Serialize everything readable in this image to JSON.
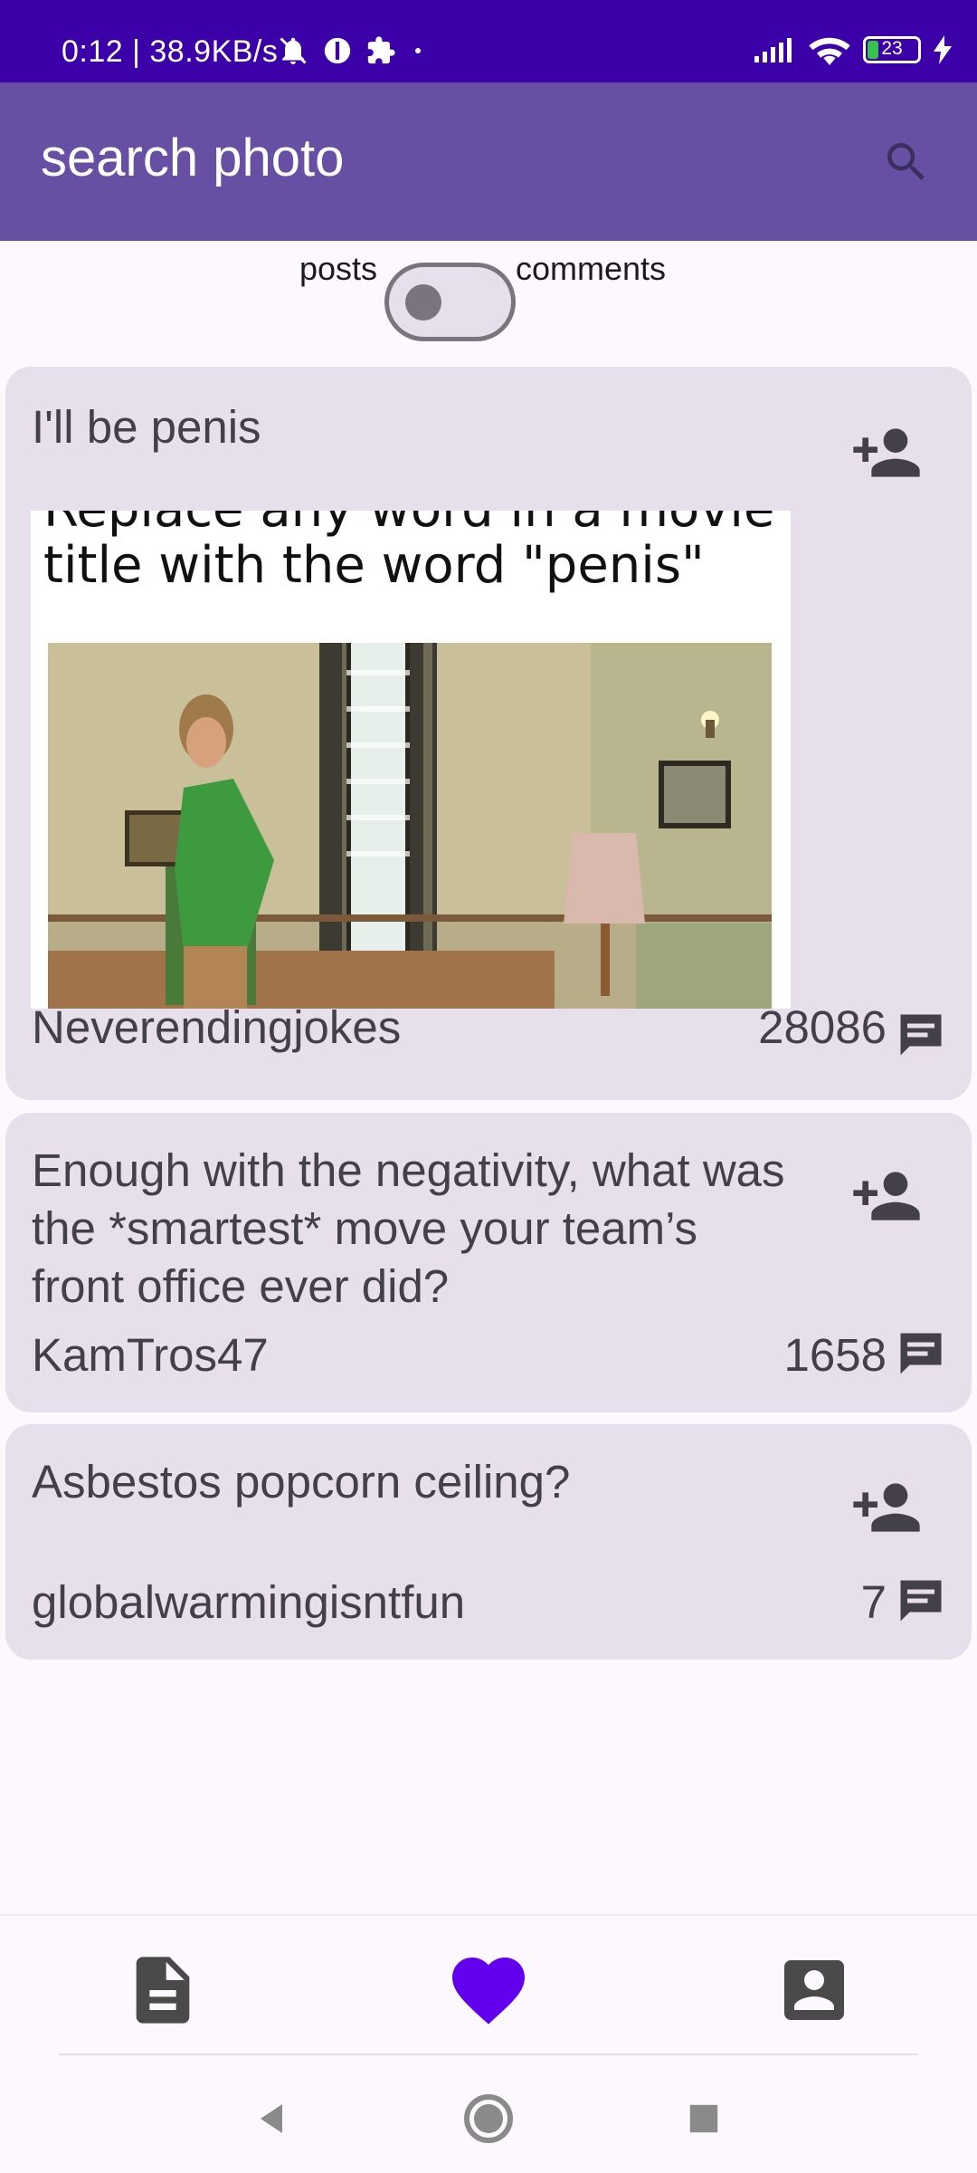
{
  "status_bar": {
    "time_and_speed": "0:12 | 38.9KB/s",
    "battery_level": "23",
    "battery_fraction": 0.23
  },
  "app_bar": {
    "title": "search photo",
    "search_icon": "search-icon"
  },
  "filter": {
    "left_label": "posts",
    "right_label": "comments",
    "selected": "posts"
  },
  "posts": [
    {
      "title": "I'll be penis",
      "image_caption": "Replace any word in a movie title with the word \"penis\"",
      "author": "Neverendingjokes",
      "comment_count": "28086"
    },
    {
      "title": "Enough with the negativity, what was the *smartest* move your team’s front office ever did?",
      "author": "KamTros47",
      "comment_count": "1658"
    },
    {
      "title": "Asbestos popcorn ceiling?",
      "author": "globalwarmingisntfun",
      "comment_count": "7"
    }
  ],
  "bottom_nav": {
    "items": [
      {
        "icon": "article-icon",
        "active": false
      },
      {
        "icon": "heart-icon",
        "active": true
      },
      {
        "icon": "profile-icon",
        "active": false
      }
    ]
  },
  "colors": {
    "status_bar": "#3b00a8",
    "app_bar": "#6750a4",
    "card": "#e7e0ec",
    "accent": "#6200ee"
  }
}
